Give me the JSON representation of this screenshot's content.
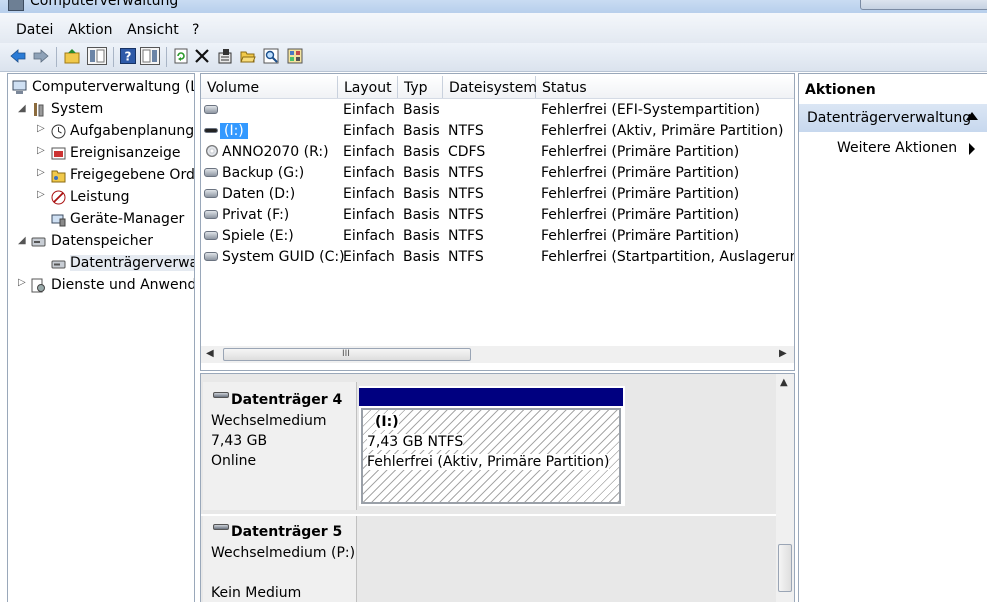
{
  "window": {
    "title": "Computerverwaltung"
  },
  "menu": [
    "Datei",
    "Aktion",
    "Ansicht",
    "?"
  ],
  "toolbar": {
    "icons": [
      "back-arrow-icon",
      "forward-arrow-icon",
      "up-folder-icon",
      "show-hide-tree-icon",
      "help-icon",
      "show-hide-action-icon",
      "refresh-icon",
      "delete-icon",
      "properties-icon",
      "open-icon",
      "search-icon",
      "export-icon"
    ]
  },
  "tree": {
    "items": [
      {
        "label": "Computerverwaltung (Lokal)",
        "icon": "computer-management-icon"
      },
      {
        "label": "System",
        "icon": "tools-icon"
      },
      {
        "label": "Aufgabenplanung",
        "icon": "clock-icon"
      },
      {
        "label": "Ereignisanzeige",
        "icon": "event-viewer-icon"
      },
      {
        "label": "Freigegebene Ordner",
        "icon": "shared-folder-icon"
      },
      {
        "label": "Leistung",
        "icon": "performance-icon"
      },
      {
        "label": "Geräte-Manager",
        "icon": "device-manager-icon"
      },
      {
        "label": "Datenspeicher",
        "icon": "storage-icon"
      },
      {
        "label": "Datenträgerverwaltung",
        "icon": "disk-management-icon"
      },
      {
        "label": "Dienste und Anwendungen",
        "icon": "services-icon"
      }
    ]
  },
  "volumes": {
    "columns": [
      "Volume",
      "Layout",
      "Typ",
      "Dateisystem",
      "Status"
    ],
    "rows": [
      {
        "volume": "",
        "layout": "Einfach",
        "type": "Basis",
        "fs": "",
        "status": "Fehlerfrei (EFI-Systempartition)",
        "icon": "disk"
      },
      {
        "volume": "(I:)",
        "layout": "Einfach",
        "type": "Basis",
        "fs": "NTFS",
        "status": "Fehlerfrei (Aktiv, Primäre Partition)",
        "icon": "removable",
        "selected": true
      },
      {
        "volume": "ANNO2070 (R:)",
        "layout": "Einfach",
        "type": "Basis",
        "fs": "CDFS",
        "status": "Fehlerfrei (Primäre Partition)",
        "icon": "cd"
      },
      {
        "volume": "Backup (G:)",
        "layout": "Einfach",
        "type": "Basis",
        "fs": "NTFS",
        "status": "Fehlerfrei (Primäre Partition)",
        "icon": "disk"
      },
      {
        "volume": "Daten (D:)",
        "layout": "Einfach",
        "type": "Basis",
        "fs": "NTFS",
        "status": "Fehlerfrei (Primäre Partition)",
        "icon": "disk"
      },
      {
        "volume": "Privat (F:)",
        "layout": "Einfach",
        "type": "Basis",
        "fs": "NTFS",
        "status": "Fehlerfrei (Primäre Partition)",
        "icon": "disk"
      },
      {
        "volume": "Spiele (E:)",
        "layout": "Einfach",
        "type": "Basis",
        "fs": "NTFS",
        "status": "Fehlerfrei (Primäre Partition)",
        "icon": "disk"
      },
      {
        "volume": "System GUID (C:)",
        "layout": "Einfach",
        "type": "Basis",
        "fs": "NTFS",
        "status": "Fehlerfrei (Startpartition, Auslagerungsdatei)",
        "icon": "disk"
      }
    ],
    "scroll_grip": "III"
  },
  "disks": [
    {
      "name": "Datenträger 4",
      "kind": "Wechselmedium",
      "size": "7,43 GB",
      "state": "Online",
      "partition": {
        "label": "(I:)",
        "size_fs": "7,43 GB NTFS",
        "status": "Fehlerfrei (Aktiv, Primäre Partition)"
      }
    },
    {
      "name": "Datenträger 5",
      "kind": "Wechselmedium (P:)",
      "state": "Kein Medium"
    }
  ],
  "actions": {
    "title": "Aktionen",
    "section": "Datenträgerverwaltung",
    "more": "Weitere Aktionen"
  }
}
